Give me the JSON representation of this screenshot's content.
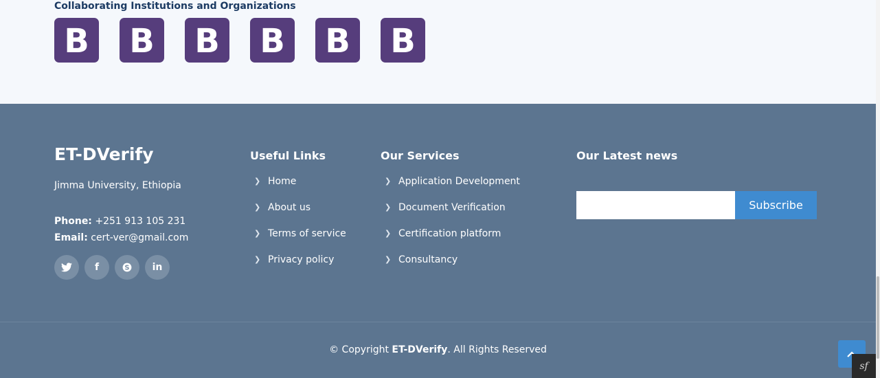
{
  "collab": {
    "title": "Collaborating Institutions and Organizations",
    "logos": [
      "B",
      "B",
      "B",
      "B",
      "B",
      "B"
    ]
  },
  "footer": {
    "brand": "ET-DVerify",
    "address": "Jimma University, Ethiopia",
    "phone_label": "Phone:",
    "phone": "+251 913 105 231",
    "email_label": "Email:",
    "email": "cert-ver@gmail.com",
    "social": [
      {
        "icon": "twitter-icon",
        "glyph": "🐦"
      },
      {
        "icon": "facebook-icon",
        "glyph": "f"
      },
      {
        "icon": "skype-icon",
        "glyph": "S"
      },
      {
        "icon": "linkedin-icon",
        "glyph": "in"
      }
    ],
    "useful_links": {
      "title": "Useful Links",
      "items": [
        "Home",
        "About us",
        "Terms of service",
        "Privacy policy"
      ]
    },
    "services": {
      "title": "Our Services",
      "items": [
        "Application Development",
        "Document Verification",
        "Certification platform",
        "Consultancy"
      ]
    },
    "news": {
      "title": "Our Latest news",
      "input_value": "",
      "subscribe_label": "Subscribe"
    },
    "copyright_prefix": "© Copyright",
    "copyright_brand": "ET-DVerify",
    "copyright_suffix": ". All Rights Reserved"
  },
  "back_to_top_icon": "arrow-up-icon",
  "symfony_badge": "sf"
}
